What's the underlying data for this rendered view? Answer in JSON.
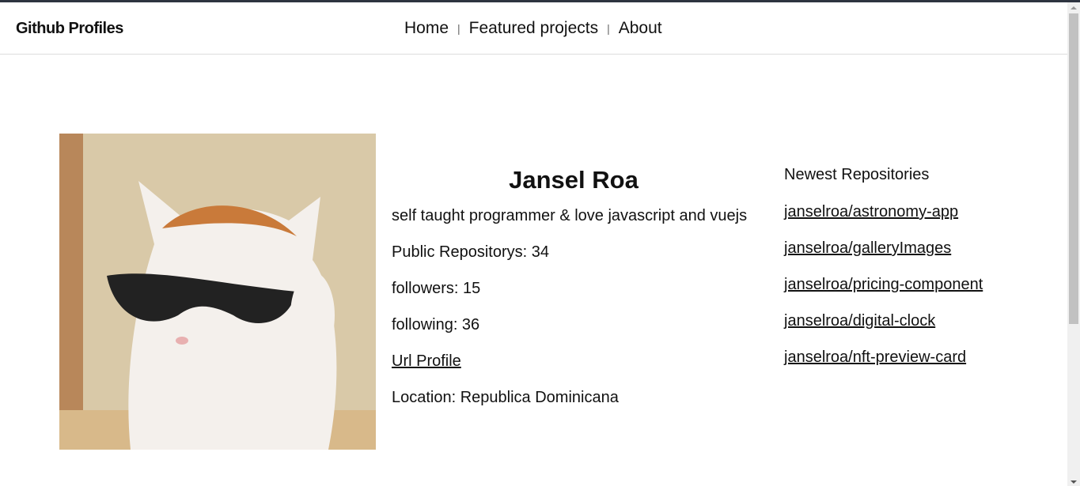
{
  "header": {
    "brand": "Github Profiles",
    "nav": [
      {
        "label": "Home"
      },
      {
        "label": "Featured projects"
      },
      {
        "label": "About"
      }
    ],
    "separator": "|"
  },
  "profile": {
    "name": "Jansel Roa",
    "bio": "self taught programmer & love javascript and vuejs",
    "public_repos": "Public Repositorys: 34",
    "followers": "followers: 15",
    "following": "following: 36",
    "url_label": "Url Profile",
    "location": "Location: Republica Dominicana"
  },
  "repos": {
    "title": "Newest Repositories",
    "items": [
      "janselroa/astronomy-app",
      "janselroa/galleryImages",
      "janselroa/pricing-component",
      "janselroa/digital-clock",
      "janselroa/nft-preview-card"
    ]
  }
}
